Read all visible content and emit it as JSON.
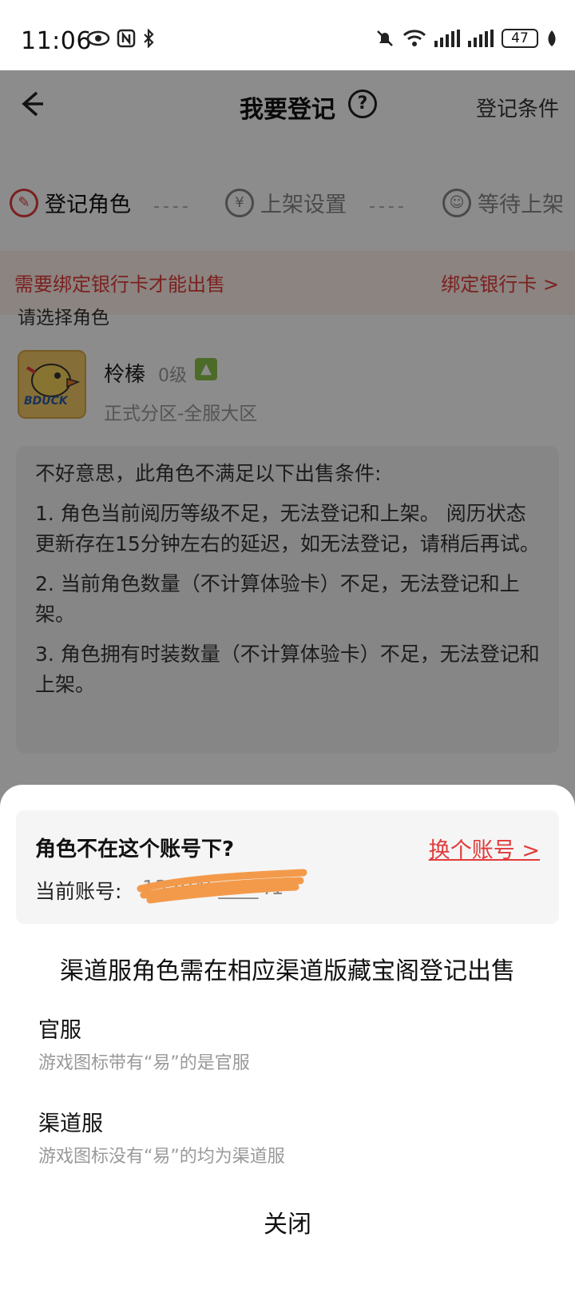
{
  "status_bar": {
    "time": "11:06",
    "battery": "47"
  },
  "navbar": {
    "title": "我要登记",
    "help": "?",
    "right_label": "登记条件"
  },
  "steps": [
    {
      "label": "登记角色",
      "icon": "edit-icon"
    },
    {
      "label": "上架设置",
      "icon": "yuan-icon"
    },
    {
      "label": "等待上架",
      "icon": "person-icon"
    }
  ],
  "notice": {
    "text": "需要绑定银行卡才能出售",
    "action": "绑定银行卡 >"
  },
  "select_label": "请选择角色",
  "role": {
    "name": "柃榛",
    "level": "0级",
    "server": "正式分区-全服大区",
    "avatar_text": "BDUCK"
  },
  "conditions": {
    "intro": "不好意思，此角色不满足以下出售条件:",
    "items": [
      "1. 角色当前阅历等级不足，无法登记和上架。 阅历状态更新存在15分钟左右的延迟，如无法登记，请稍后再试。",
      "2. 当前角色数量（不计算体验卡）不足，无法登记和上架。",
      "3. 角色拥有时装数量（不计算体验卡）不足，无法登记和上架。"
    ]
  },
  "sheet": {
    "account_question": "角色不在这个账号下?",
    "switch_account": "换个账号 >",
    "current_account_label": "当前账号:",
    "current_account_value": "132045____41",
    "channel_title": "渠道服角色需在相应渠道版藏宝阁登记出售",
    "official_title": "官服",
    "official_desc": "游戏图标带有“易”的是官服",
    "channel_server_title": "渠道服",
    "channel_server_desc": "游戏图标没有“易”的均为渠道服",
    "close": "关闭"
  },
  "colors": {
    "accent": "#e23b3b",
    "scribble": "#f39a4a",
    "overlay": "rgba(0,0,0,0.45)"
  }
}
